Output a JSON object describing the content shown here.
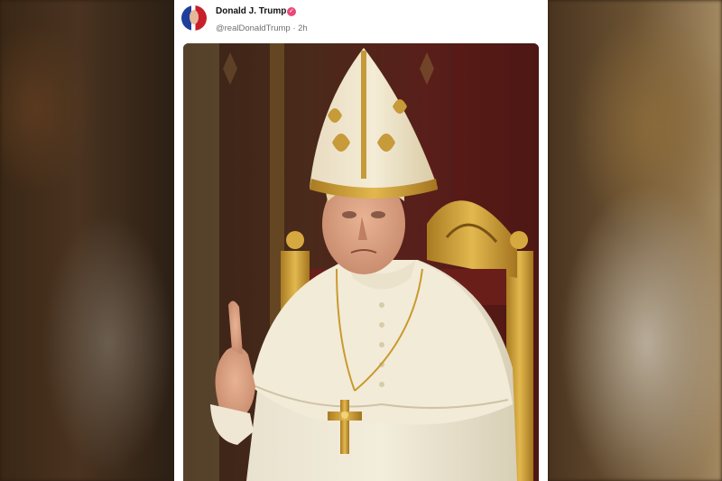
{
  "post": {
    "author": {
      "display_name": "Donald J. Trump",
      "handle": "@realDonaldTrump",
      "timestamp": "2h",
      "separator": "·",
      "verified": true
    },
    "media": {
      "description_icon": "image"
    }
  },
  "colors": {
    "card_background": "#ffffff",
    "verified_badge": "#e8497a",
    "handle_text": "#707070"
  }
}
